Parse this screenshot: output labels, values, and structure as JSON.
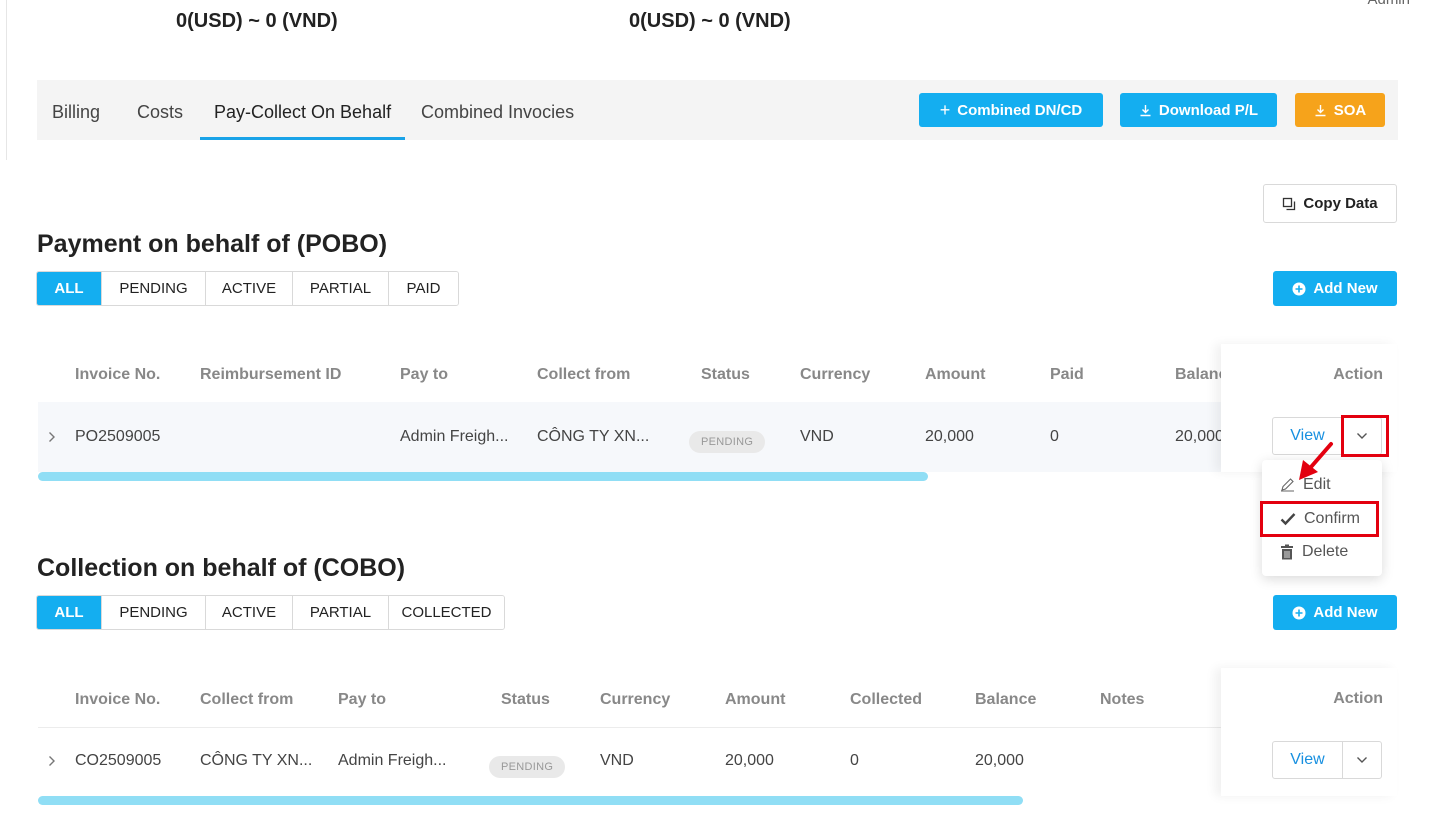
{
  "header": {
    "corner_user": "Admin",
    "total_left": "0(USD) ~ 0 (VND)",
    "total_right": "0(USD) ~ 0 (VND)"
  },
  "tabs": [
    {
      "label": "Billing"
    },
    {
      "label": "Costs"
    },
    {
      "label": "Pay-Collect On Behalf"
    },
    {
      "label": "Combined Invocies"
    }
  ],
  "toolbar": {
    "combined_label": "Combined DN/CD",
    "download_label": "Download P/L",
    "soa_label": "SOA",
    "copy_label": "Copy Data"
  },
  "colors": {
    "primary": "#14aef0",
    "warning": "#f6a31b",
    "highlight": "#e3000f"
  },
  "pobo": {
    "title": "Payment on behalf of (POBO)",
    "filters": [
      "ALL",
      "PENDING",
      "ACTIVE",
      "PARTIAL",
      "PAID"
    ],
    "add_label": "Add New",
    "columns": [
      "Invoice No.",
      "Reimbursement ID",
      "Pay to",
      "Collect from",
      "Status",
      "Currency",
      "Amount",
      "Paid",
      "Balance"
    ],
    "action_header": "Action",
    "row": {
      "invoice": "PO2509005",
      "reimbursement": "",
      "pay_to": "Admin Freigh...",
      "collect_from": "CÔNG TY XN...",
      "status": "PENDING",
      "currency": "VND",
      "amount": "20,000",
      "paid": "0",
      "balance": "20,000"
    },
    "view_label": "View"
  },
  "menu": {
    "edit": "Edit",
    "confirm": "Confirm",
    "delete": "Delete"
  },
  "cobo": {
    "title": "Collection on behalf of (COBO)",
    "filters": [
      "ALL",
      "PENDING",
      "ACTIVE",
      "PARTIAL",
      "COLLECTED"
    ],
    "add_label": "Add New",
    "columns": [
      "Invoice No.",
      "Collect from",
      "Pay to",
      "Status",
      "Currency",
      "Amount",
      "Collected",
      "Balance",
      "Notes"
    ],
    "action_header": "Action",
    "row": {
      "invoice": "CO2509005",
      "collect_from": "CÔNG TY XN...",
      "pay_to": "Admin Freigh...",
      "status": "PENDING",
      "currency": "VND",
      "amount": "20,000",
      "collected": "0",
      "balance": "20,000"
    },
    "view_label": "View"
  }
}
